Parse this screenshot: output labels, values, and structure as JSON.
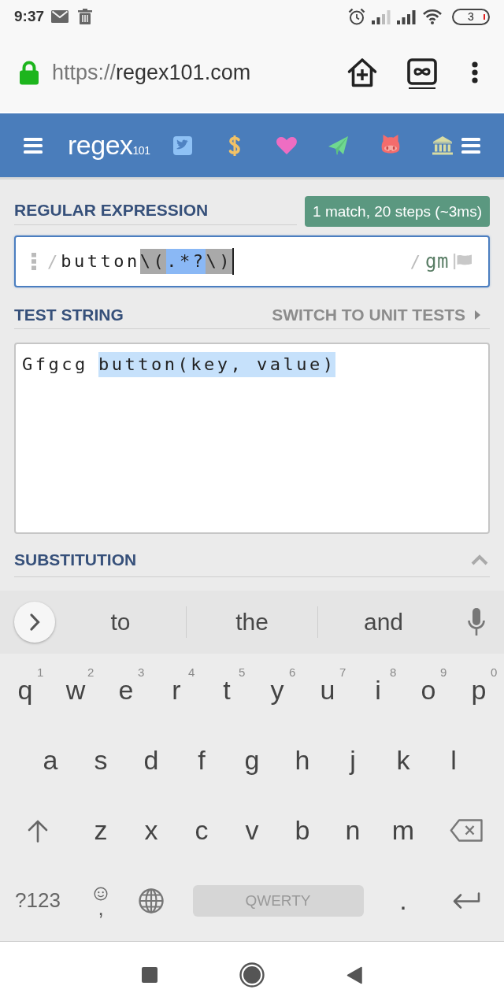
{
  "status_bar": {
    "time": "9:37",
    "battery": "3"
  },
  "browser_bar": {
    "url_scheme": "https://",
    "url_host": "regex101.com"
  },
  "site_header": {
    "logo": "regex",
    "logo_suffix": "101"
  },
  "regex_section": {
    "title": "REGULAR EXPRESSION",
    "match_info": "1 match, 20 steps (~3ms)",
    "open_delimiter": "/",
    "pattern": [
      {
        "text": "button",
        "kind": "literal"
      },
      {
        "text": "\\(",
        "kind": "escape"
      },
      {
        "text": ".*?",
        "kind": "token"
      },
      {
        "text": "\\)",
        "kind": "escape"
      }
    ],
    "close_delimiter": "/",
    "flags": "gm"
  },
  "test_section": {
    "title": "TEST STRING",
    "switch_link": "SWITCH TO UNIT TESTS",
    "text": [
      {
        "text": "Gfgcg",
        "match": false
      },
      {
        "text": "button(key, value)",
        "match": true
      }
    ]
  },
  "substitution_section": {
    "title": "SUBSTITUTION"
  },
  "keyboard": {
    "suggestions": [
      "to",
      "the",
      "and"
    ],
    "letter_rows": [
      [
        {
          "key": "q",
          "hint": "1"
        },
        {
          "key": "w",
          "hint": "2"
        },
        {
          "key": "e",
          "hint": "3"
        },
        {
          "key": "r",
          "hint": "4"
        },
        {
          "key": "t",
          "hint": "5"
        },
        {
          "key": "y",
          "hint": "6"
        },
        {
          "key": "u",
          "hint": "7"
        },
        {
          "key": "i",
          "hint": "8"
        },
        {
          "key": "o",
          "hint": "9"
        },
        {
          "key": "p",
          "hint": "0"
        }
      ],
      [
        {
          "key": "a"
        },
        {
          "key": "s"
        },
        {
          "key": "d"
        },
        {
          "key": "f"
        },
        {
          "key": "g"
        },
        {
          "key": "h"
        },
        {
          "key": "j"
        },
        {
          "key": "k"
        },
        {
          "key": "l"
        }
      ],
      [
        {
          "key": "z"
        },
        {
          "key": "x"
        },
        {
          "key": "c"
        },
        {
          "key": "v"
        },
        {
          "key": "b"
        },
        {
          "key": "n"
        },
        {
          "key": "m"
        }
      ]
    ],
    "symbols_key": "?123",
    "comma_key": ",",
    "space_key": "QWERTY",
    "period_key": "."
  }
}
